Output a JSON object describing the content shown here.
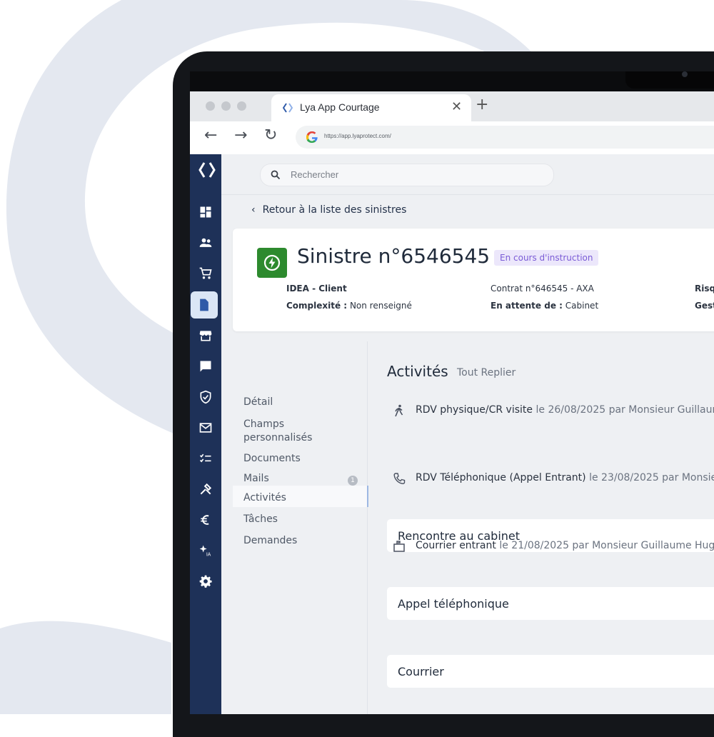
{
  "browser": {
    "tab_title": "Lya App Courtage",
    "url": "https://app.lyaprotect.com/"
  },
  "search": {
    "placeholder": "Rechercher"
  },
  "back_link": "Retour à la liste des sinistres",
  "claim": {
    "title": "Sinistre n°6546545",
    "status": "En cours d'instruction",
    "client": "IDEA - Client",
    "complexity_label": "Complexité :",
    "complexity_value": "Non renseigné",
    "contract": "Contrat n°646545 - AXA",
    "waiting_label": "En attente de :",
    "waiting_value": "Cabinet",
    "col3_row1": "Risq",
    "col3_row2": "Gest"
  },
  "subnav": {
    "items": [
      "Détail",
      "Champs personnalisés",
      "Documents",
      "Mails",
      "Activités",
      "Tâches",
      "Demandes"
    ],
    "mails_badge": "1"
  },
  "activities": {
    "title": "Activités",
    "collapse_all": "Tout Replier",
    "entries": [
      {
        "icon": "walk-icon",
        "type": "RDV physique/CR visite",
        "when": "le 26/08/2025 par Monsieur Guillaum",
        "body": "Rencontre au cabinet"
      },
      {
        "icon": "phone-icon",
        "type": "RDV Téléphonique (Appel Entrant)",
        "when": "le 23/08/2025 par Monsie",
        "body": "Appel téléphonique"
      },
      {
        "icon": "mailbox-icon",
        "type": "Courrier entrant",
        "when": "le 21/08/2025 par Monsieur Guillaume Hugu",
        "body": "Courrier"
      }
    ]
  },
  "colors": {
    "sidebar": "#1e3158",
    "accent_green": "#2d8a2e",
    "status_purple": "#7a5bd6"
  }
}
